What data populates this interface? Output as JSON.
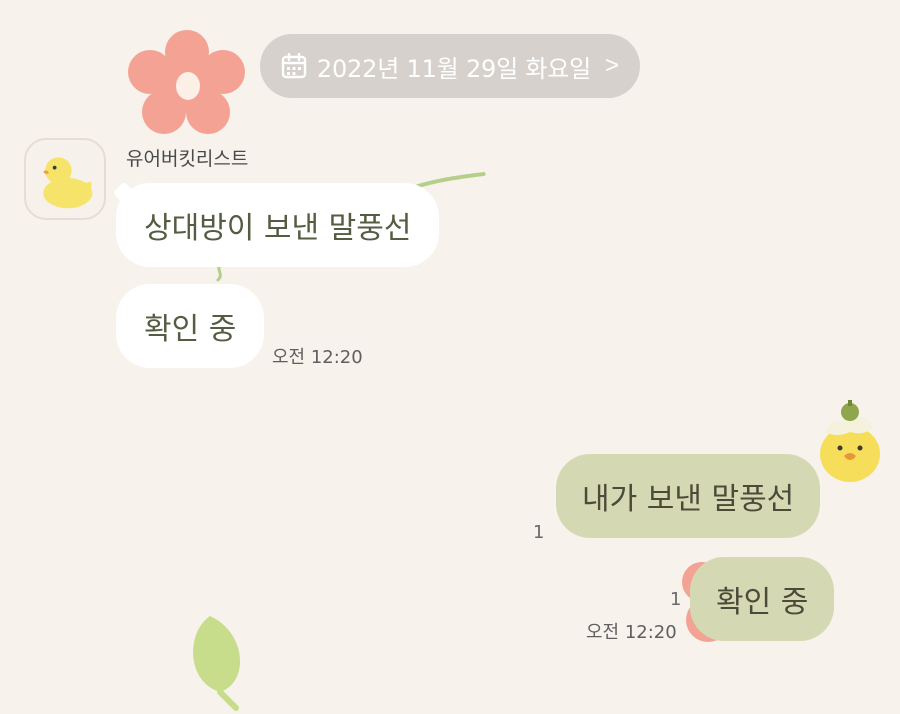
{
  "date_banner": {
    "icon": "calendar-icon",
    "text": "2022년 11월 29일 화요일",
    "chevron": ">"
  },
  "incoming": {
    "sender_name": "유어버킷리스트",
    "avatar_icon": "duck-icon",
    "messages": [
      {
        "text": "상대방이 보낸 말풍선"
      },
      {
        "text": "확인 중",
        "time": "오전 12:20"
      }
    ]
  },
  "outgoing": {
    "messages": [
      {
        "text": "내가 보낸 말풍선",
        "read_count": "1"
      },
      {
        "text": "확인 중",
        "read_count": "1",
        "time": "오전 12:20"
      }
    ]
  },
  "colors": {
    "background": "#f7f2ec",
    "date_pill": "#d6d1cc",
    "received_bubble": "#ffffff",
    "sent_bubble": "#d5d9b3",
    "bubble_text": "#545c42"
  }
}
